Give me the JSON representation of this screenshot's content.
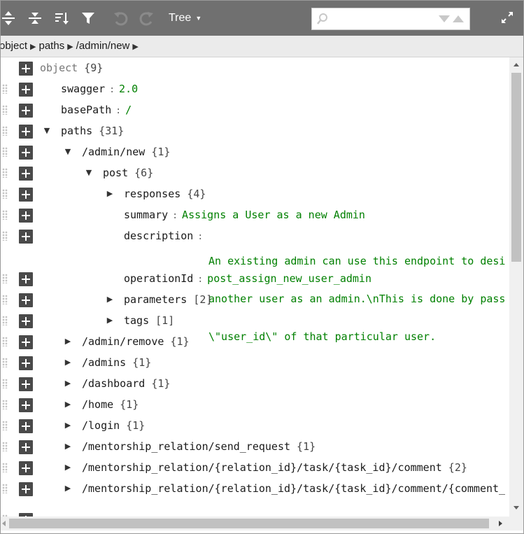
{
  "toolbar": {
    "mode_label": "Tree",
    "search_value": "",
    "search_placeholder": ""
  },
  "breadcrumb": [
    "object",
    "paths",
    "/admin/new"
  ],
  "tree": {
    "rows": [
      {
        "label": "object",
        "count": "{9}"
      },
      {
        "label": "swagger",
        "value": "2.0"
      },
      {
        "label": "basePath",
        "value": "/"
      },
      {
        "label": "paths",
        "count": "{31}"
      },
      {
        "label": "/admin/new",
        "count": "{1}"
      },
      {
        "label": "post",
        "count": "{6}"
      },
      {
        "label": "responses",
        "count": "{4}"
      },
      {
        "label": "summary",
        "value": "Assigns a User as a new Admin"
      },
      {
        "label": "description",
        "value_lines": [
          "An existing admin can use this endpoint to desi",
          "another user as an admin.\\nThis is done by pass",
          "\\\"user_id\\\" of that particular user."
        ]
      },
      {
        "label": "operationId",
        "value": "post_assign_new_user_admin"
      },
      {
        "label": "parameters",
        "count": "[2]"
      },
      {
        "label": "tags",
        "count": "[1]"
      },
      {
        "label": "/admin/remove",
        "count": "{1}"
      },
      {
        "label": "/admins",
        "count": "{1}"
      },
      {
        "label": "/dashboard",
        "count": "{1}"
      },
      {
        "label": "/home",
        "count": "{1}"
      },
      {
        "label": "/login",
        "count": "{1}"
      },
      {
        "label": "/mentorship_relation/send_request",
        "count": "{1}"
      },
      {
        "label": "/mentorship_relation/{relation_id}/task/{task_id}/comment",
        "count": "{2}"
      },
      {
        "label": "/mentorship_relation/{relation_id}/task/{task_id}/comment/{comment_",
        "count": ""
      }
    ]
  },
  "colors": {
    "toolbar_bg": "#707070",
    "navbar_bg": "#ebebeb",
    "value_text": "#008000"
  }
}
